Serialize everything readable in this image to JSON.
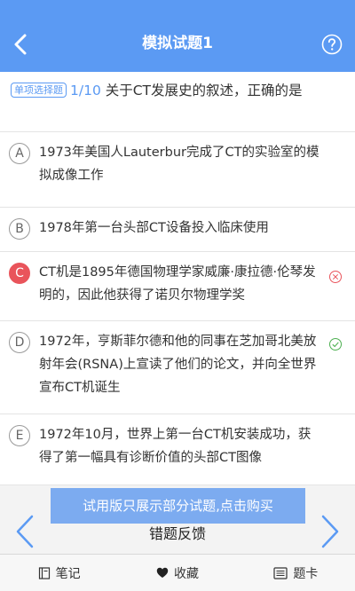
{
  "header": {
    "title": "模拟试题1",
    "back_icon": "chevron-left-icon",
    "help_icon": "question-circle-icon",
    "color": "#5b9af3"
  },
  "question": {
    "type_label": "单项选择题",
    "index": "1/10",
    "text": " 关于CT发展史的叙述，正确的是"
  },
  "options": [
    {
      "letter": "A",
      "text": "1973年美国人Lauterbur完成了CT的实验室的模拟成像工作",
      "state": "normal"
    },
    {
      "letter": "B",
      "text": "1978年第一台头部CT设备投入临床使用",
      "state": "normal"
    },
    {
      "letter": "C",
      "text": "CT机是1895年德国物理学家威廉·康拉德·伦琴发明的，因此他获得了诺贝尔物理学奖",
      "state": "wrong",
      "mark_icon": "x-circle-icon"
    },
    {
      "letter": "D",
      "text": "1972年，亨斯菲尔德和他的同事在芝加哥北美放射年会(RSNA)上宣读了他们的论文，并向全世界宣布CT机诞生",
      "state": "correct",
      "mark_icon": "check-circle-icon"
    },
    {
      "letter": "E",
      "text": "1972年10月，世界上第一台CT机安装成功，获得了第一幅具有诊断价值的头部CT图像",
      "state": "normal"
    }
  ],
  "purchase_banner": "试用版只展示部分试题,点击购买",
  "feedback": "错题反馈",
  "bottom_tabs": [
    {
      "label": "笔记",
      "icon": "notebook-icon"
    },
    {
      "label": "收藏",
      "icon": "heart-icon"
    },
    {
      "label": "题卡",
      "icon": "answer-card-icon"
    }
  ],
  "colors": {
    "accent": "#5b9af3",
    "wrong": "#e9545b",
    "correct": "#4caf50"
  }
}
